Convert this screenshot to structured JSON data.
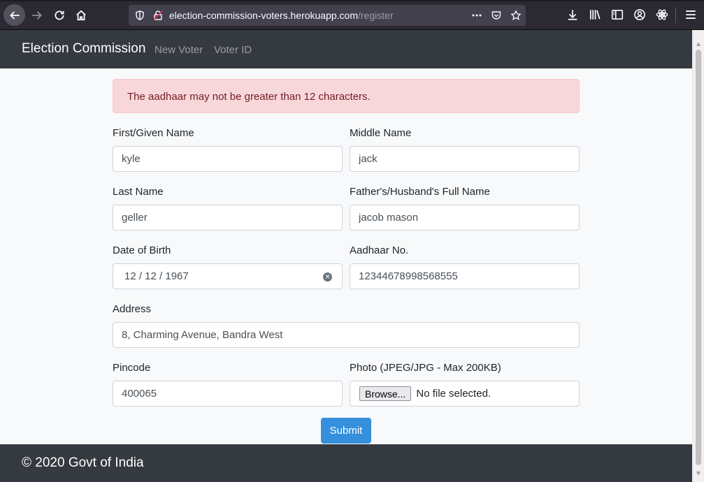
{
  "browser": {
    "url_host": "election-commission-voters.herokuapp.com",
    "url_path": "/register"
  },
  "navbar": {
    "brand": "Election Commission",
    "links": [
      "New Voter",
      "Voter ID"
    ]
  },
  "alert": {
    "message": "The aadhaar may not be greater than 12 characters."
  },
  "form": {
    "first_name": {
      "label": "First/Given Name",
      "value": "kyle"
    },
    "middle_name": {
      "label": "Middle Name",
      "value": "jack"
    },
    "last_name": {
      "label": "Last Name",
      "value": "geller"
    },
    "guardian_name": {
      "label": "Father's/Husband's Full Name",
      "value": "jacob mason"
    },
    "dob": {
      "label": "Date of Birth",
      "value": "12 / 12 / 1967"
    },
    "aadhaar": {
      "label": "Aadhaar No.",
      "value": "12344678998568555"
    },
    "address": {
      "label": "Address",
      "value": "8, Charming Avenue, Bandra West"
    },
    "pincode": {
      "label": "Pincode",
      "value": "400065"
    },
    "photo": {
      "label": "Photo (JPEG/JPG - Max 200KB)",
      "browse_label": "Browse...",
      "file_status": "No file selected."
    },
    "submit_label": "Submit"
  },
  "footer": {
    "copyright": "© 2020 Govt of India"
  }
}
